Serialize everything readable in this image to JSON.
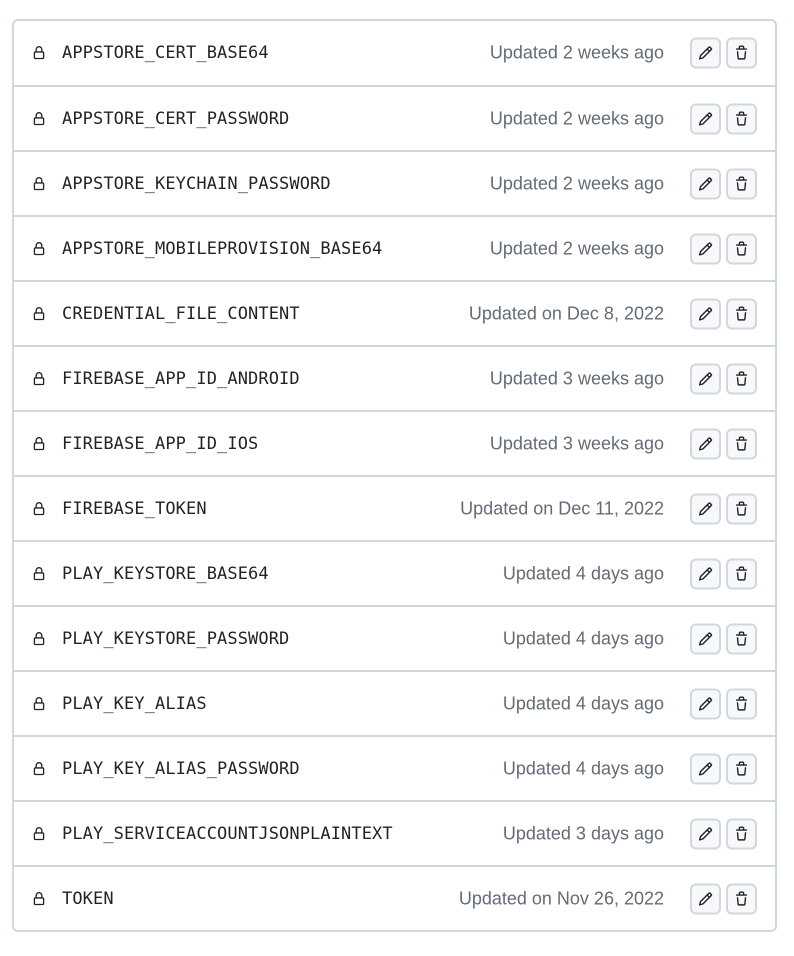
{
  "secrets": [
    {
      "name": "APPSTORE_CERT_BASE64",
      "updated": "Updated 2 weeks ago",
      "icon": "lock-icon"
    },
    {
      "name": "APPSTORE_CERT_PASSWORD",
      "updated": "Updated 2 weeks ago",
      "icon": "lock-icon"
    },
    {
      "name": "APPSTORE_KEYCHAIN_PASSWORD",
      "updated": "Updated 2 weeks ago",
      "icon": "lock-icon"
    },
    {
      "name": "APPSTORE_MOBILEPROVISION_BASE64",
      "updated": "Updated 2 weeks ago",
      "icon": "lock-icon"
    },
    {
      "name": "CREDENTIAL_FILE_CONTENT",
      "updated": "Updated on Dec 8, 2022",
      "icon": "lock-icon"
    },
    {
      "name": "FIREBASE_APP_ID_ANDROID",
      "updated": "Updated 3 weeks ago",
      "icon": "lock-icon"
    },
    {
      "name": "FIREBASE_APP_ID_IOS",
      "updated": "Updated 3 weeks ago",
      "icon": "lock-icon"
    },
    {
      "name": "FIREBASE_TOKEN",
      "updated": "Updated on Dec 11, 2022",
      "icon": "lock-icon"
    },
    {
      "name": "PLAY_KEYSTORE_BASE64",
      "updated": "Updated 4 days ago",
      "icon": "lock-icon"
    },
    {
      "name": "PLAY_KEYSTORE_PASSWORD",
      "updated": "Updated 4 days ago",
      "icon": "lock-icon"
    },
    {
      "name": "PLAY_KEY_ALIAS",
      "updated": "Updated 4 days ago",
      "icon": "lock-icon"
    },
    {
      "name": "PLAY_KEY_ALIAS_PASSWORD",
      "updated": "Updated 4 days ago",
      "icon": "lock-icon"
    },
    {
      "name": "PLAY_SERVICEACCOUNTJSONPLAINTEXT",
      "updated": "Updated 3 days ago",
      "icon": "lock-icon"
    },
    {
      "name": "TOKEN",
      "updated": "Updated on Nov 26, 2022",
      "icon": "lock-icon"
    }
  ],
  "actions": {
    "edit_icon": "pencil-icon",
    "delete_icon": "trash-icon"
  },
  "colors": {
    "border": "#d0d7de",
    "text": "#1f2328",
    "muted": "#636c76",
    "button_bg": "#f6f8fa"
  }
}
